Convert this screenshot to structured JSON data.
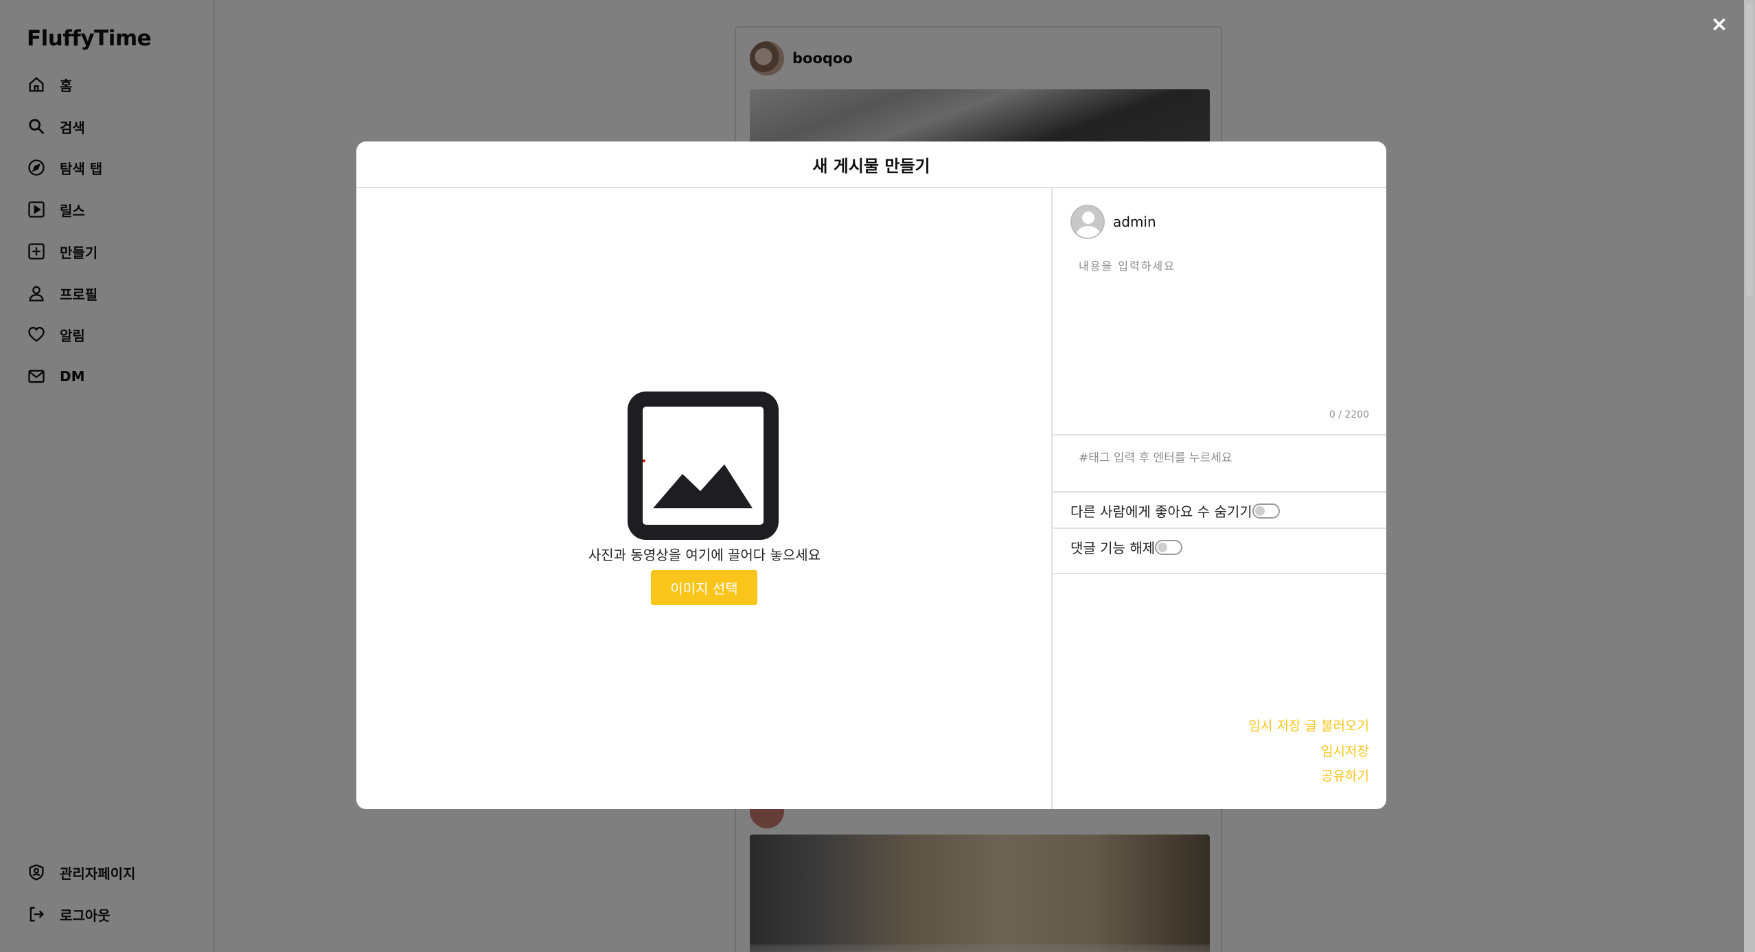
{
  "app": {
    "logo": "FluffyTime"
  },
  "sidebar": {
    "items": [
      {
        "label": "홈",
        "icon": "home-icon"
      },
      {
        "label": "검색",
        "icon": "search-icon"
      },
      {
        "label": "탐색 탭",
        "icon": "compass-icon"
      },
      {
        "label": "릴스",
        "icon": "reels-icon"
      },
      {
        "label": "만들기",
        "icon": "plus-square-icon"
      },
      {
        "label": "프로필",
        "icon": "user-icon"
      },
      {
        "label": "알림",
        "icon": "heart-icon"
      },
      {
        "label": "DM",
        "icon": "mail-icon"
      }
    ],
    "bottom_items": [
      {
        "label": "관리자페이지",
        "icon": "shield-user-icon"
      },
      {
        "label": "로그아웃",
        "icon": "logout-icon"
      }
    ]
  },
  "feed": {
    "username": "booqoo"
  },
  "modal": {
    "close": "×",
    "title": "새 게시물 만들기",
    "upload": {
      "drop_text": "사진과 동영상을 여기에 끌어다 놓으세요",
      "select_button": "이미지 선택",
      "icon": "image-icon"
    },
    "form": {
      "username": "admin",
      "content_placeholder": "내용을 입력하세요",
      "char_count": "0 / 2200",
      "tag_placeholder": "#태그 입력 후 엔터를 누르세요",
      "hide_likes_label": "다른 사람에게 좋아요 수 숨기기",
      "disable_comments_label": "댓글 기능 해제",
      "load_draft_link": "임시 저장 글 불러오기",
      "save_draft_link": "임시저장",
      "share_link": "공유하기"
    }
  },
  "colors": {
    "accent": "#f9c51a",
    "overlay": "rgba(0,0,0,0.5)"
  }
}
